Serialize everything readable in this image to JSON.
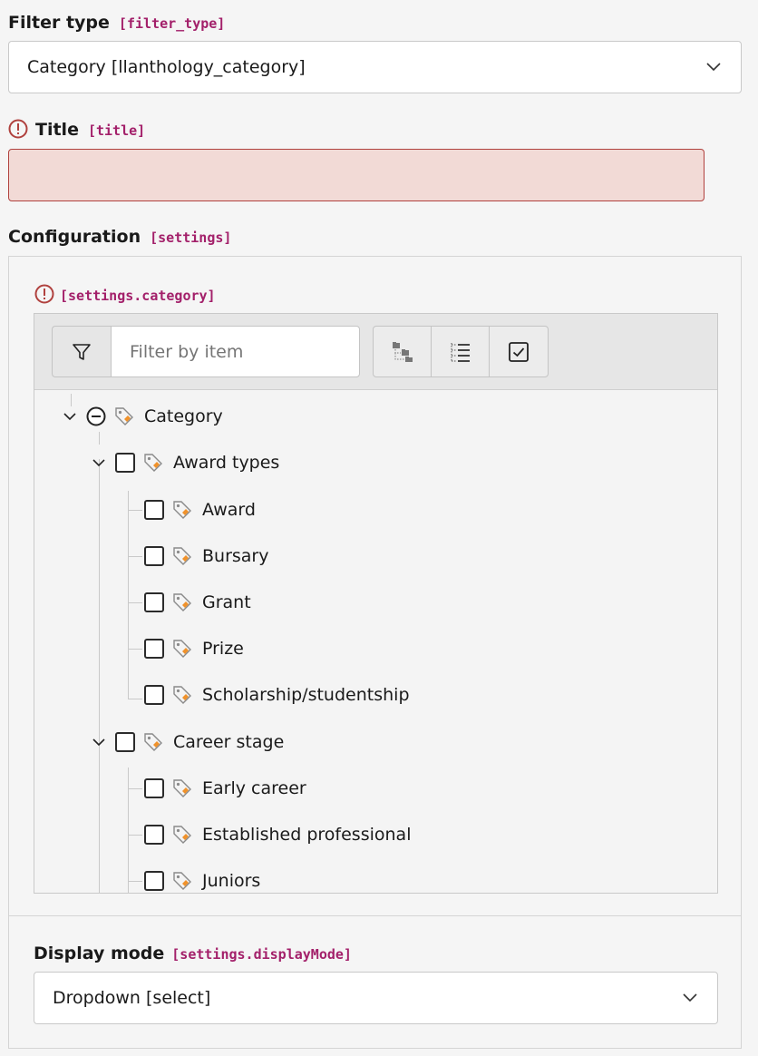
{
  "filter_type": {
    "label": "Filter type",
    "key": "[filter_type]",
    "value": "Category [llanthology_category]"
  },
  "title_field": {
    "label": "Title",
    "key": "[title]",
    "value": "",
    "status": "error",
    "error_color": "#b0413e"
  },
  "configuration": {
    "label": "Configuration",
    "key": "[settings]",
    "category": {
      "key": "[settings.category]",
      "status": "error",
      "filter_placeholder": "Filter by item",
      "toolbar_buttons": [
        "expand-collapse-icon",
        "list-tree-icon",
        "checkbox-toggle-icon"
      ],
      "tree": {
        "root": "Category",
        "groups": [
          {
            "label": "Award types",
            "children": [
              "Award",
              "Bursary",
              "Grant",
              "Prize",
              "Scholarship/studentship"
            ]
          },
          {
            "label": "Career stage",
            "children": [
              "Early career",
              "Established professional",
              "Juniors"
            ]
          }
        ]
      }
    },
    "display_mode": {
      "label": "Display mode",
      "key": "[settings.displayMode]",
      "value": "Dropdown [select]"
    }
  },
  "colors": {
    "key_accent": "#a3206a",
    "tag_orange": "#f0922b",
    "error_bg": "#f2dad6"
  }
}
